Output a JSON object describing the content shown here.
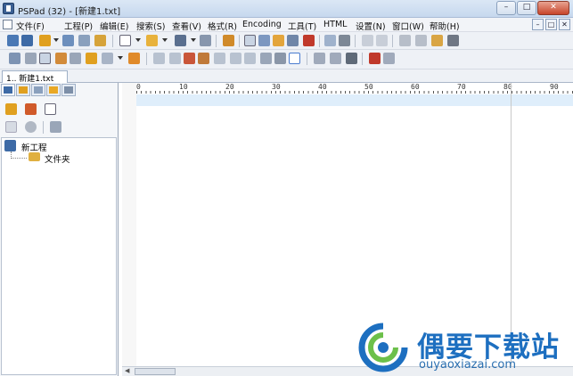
{
  "window": {
    "title": "PSPad (32) - [新建1.txt]",
    "controls": [
      "–",
      "□",
      "✕"
    ]
  },
  "menu": {
    "items": [
      "文件(F)",
      "工程(P)",
      "编辑(E)",
      "搜索(S)",
      "查看(V)",
      "格式(R)",
      "Encoding",
      "工具(T)",
      "HTML",
      "设置(N)",
      "窗口(W)",
      "帮助(H)"
    ],
    "mdi_controls": [
      "–",
      "□",
      "✕"
    ]
  },
  "tabs": {
    "active": "1.. 新建1.txt"
  },
  "project_tree": {
    "root": "新工程",
    "child": "文件夹"
  },
  "ruler": {
    "marks": [
      "0",
      "10",
      "20",
      "30",
      "40",
      "50",
      "60",
      "70",
      "80",
      "90"
    ]
  },
  "watermark": {
    "brand_cn": "偶要下载站",
    "brand_en": "ouyaoxiazai.com"
  },
  "colors": {
    "accent": "#1d6fc0",
    "current_line": "#dfeefb",
    "title_bar": "#c6d8ee"
  }
}
